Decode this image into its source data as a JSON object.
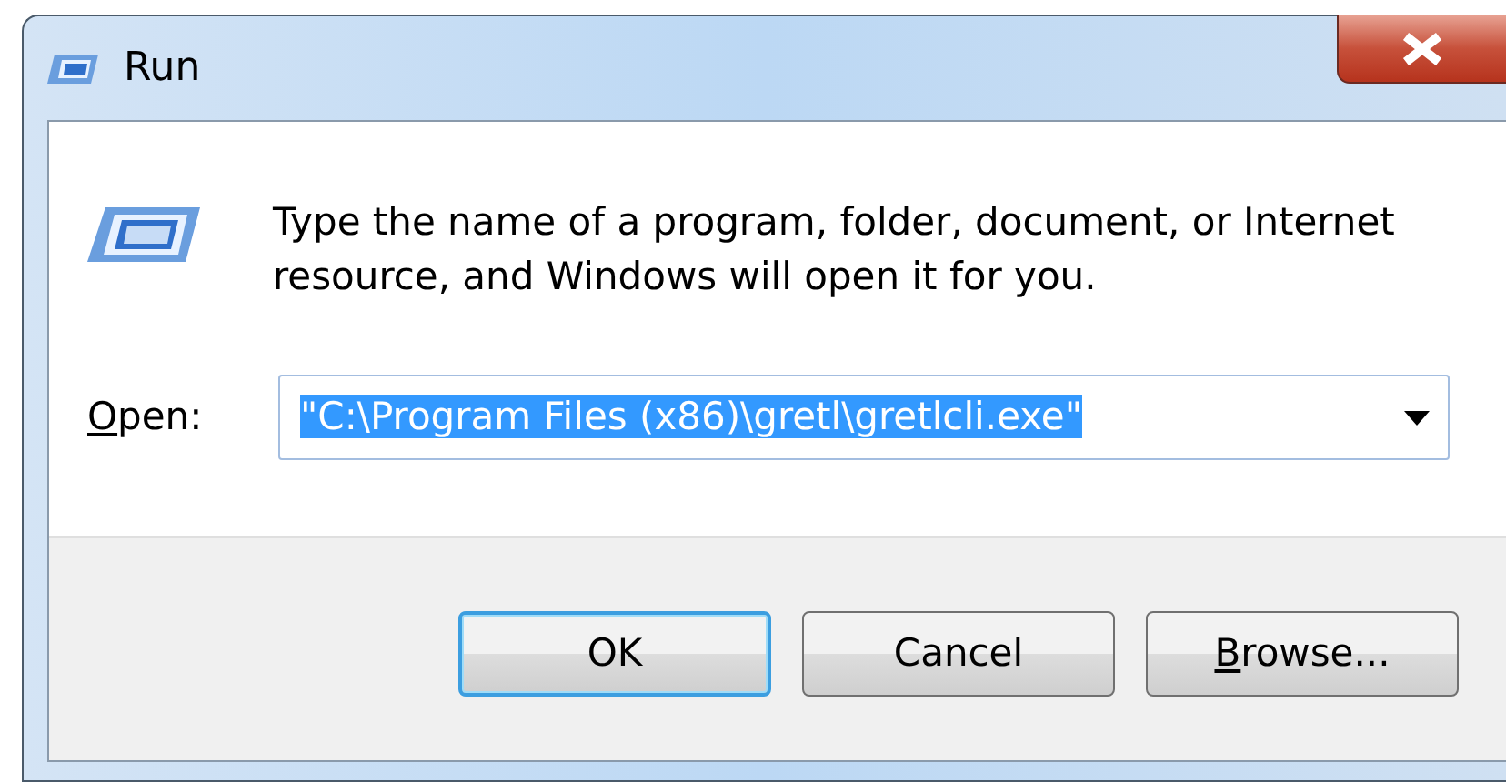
{
  "window": {
    "title": "Run"
  },
  "prompt": "Type the name of a program, folder, document, or Internet resource, and Windows will open it for you.",
  "open_field": {
    "label": "Open:",
    "label_underline_first": true,
    "value": "\"C:\\Program Files (x86)\\gretl\\gretlcli.exe\"",
    "selected": true
  },
  "buttons": [
    {
      "label": "OK",
      "default": true,
      "underline_first": false
    },
    {
      "label": "Cancel",
      "default": false,
      "underline_first": false
    },
    {
      "label": "Browse...",
      "default": false,
      "underline_first": true
    }
  ]
}
